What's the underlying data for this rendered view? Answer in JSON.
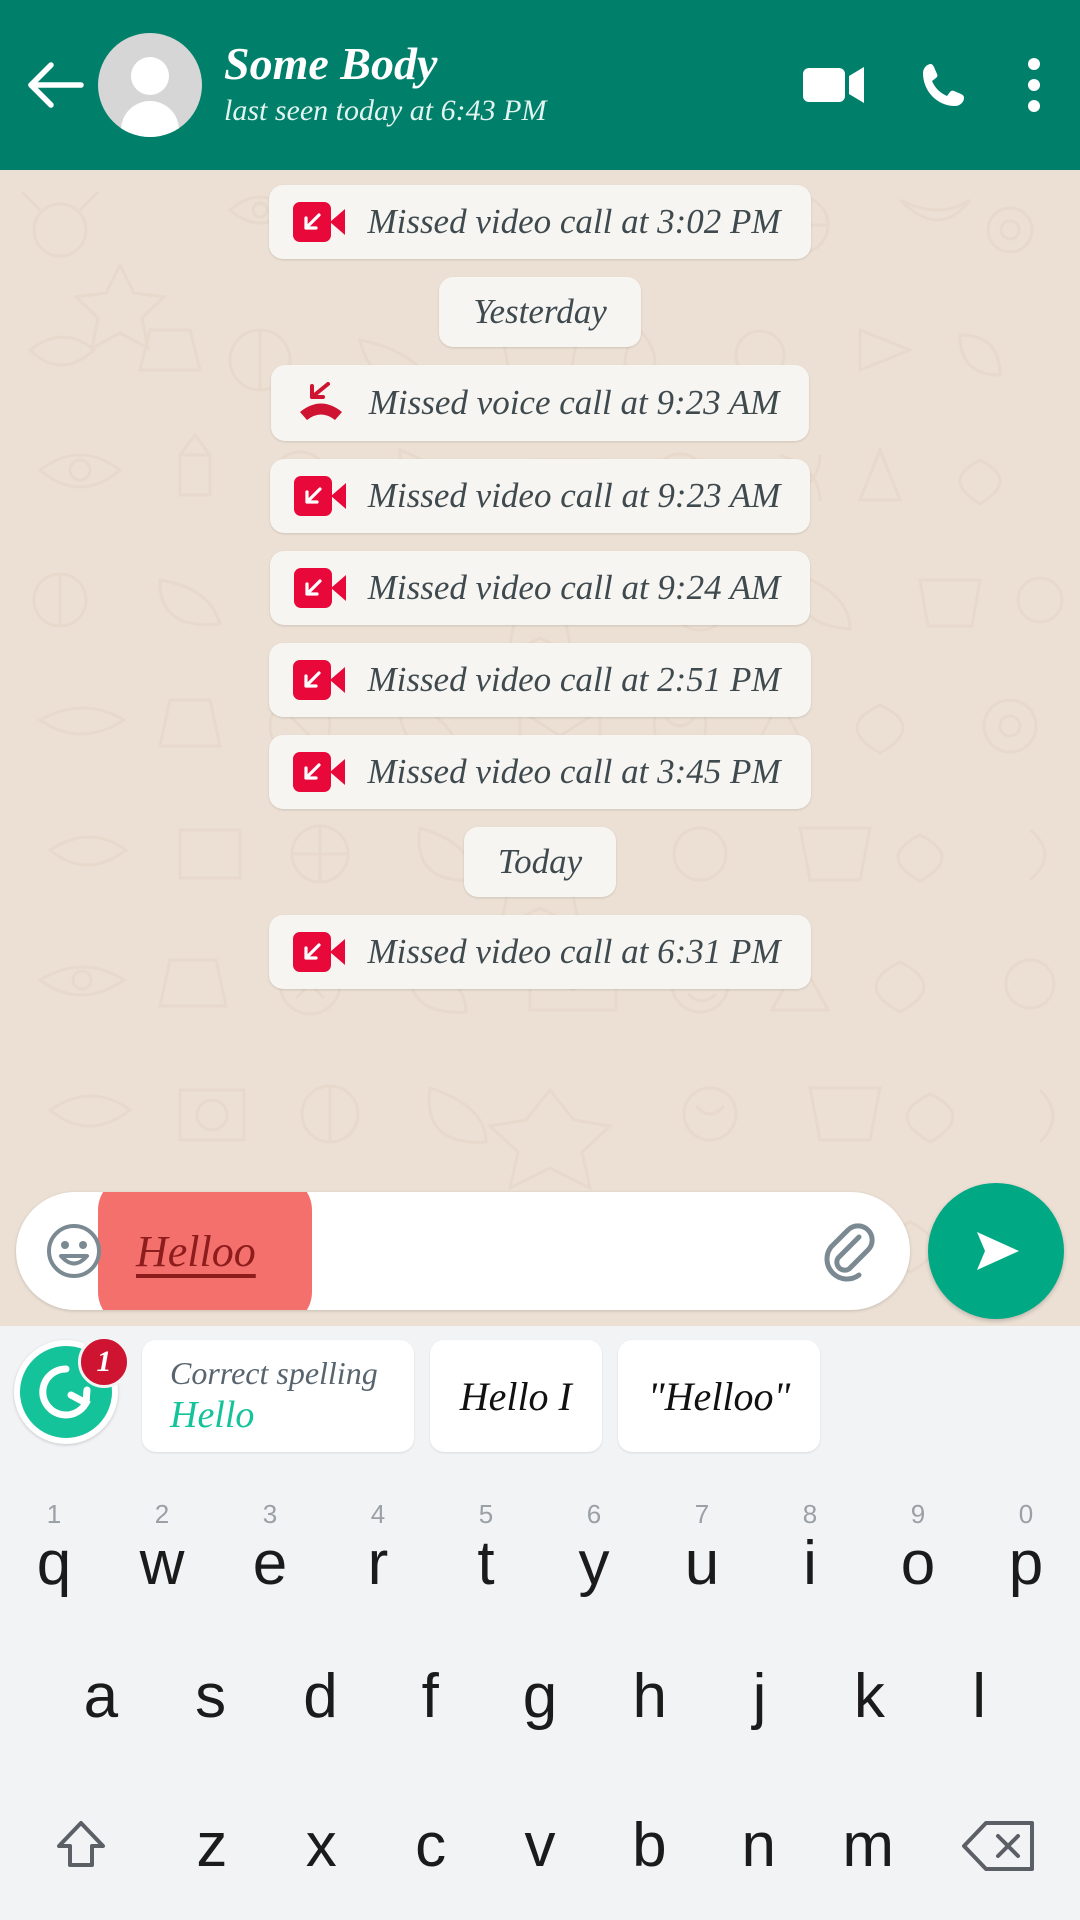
{
  "header": {
    "back_icon": "back-arrow-icon",
    "avatar_icon": "default-avatar-icon",
    "contact_name": "Some Body",
    "status": "last seen today at 6:43 PM",
    "video_call_icon": "video-camera-icon",
    "voice_call_icon": "phone-icon",
    "overflow_icon": "more-vertical-icon"
  },
  "chat": {
    "entries": [
      {
        "kind": "call",
        "call_type": "video",
        "icon": "missed-video-call-icon",
        "text": "Missed video call at 3:02 PM"
      },
      {
        "kind": "divider",
        "text": "Yesterday"
      },
      {
        "kind": "call",
        "call_type": "voice",
        "icon": "missed-voice-call-icon",
        "text": "Missed voice call at 9:23 AM"
      },
      {
        "kind": "call",
        "call_type": "video",
        "icon": "missed-video-call-icon",
        "text": "Missed video call at 9:23 AM"
      },
      {
        "kind": "call",
        "call_type": "video",
        "icon": "missed-video-call-icon",
        "text": "Missed video call at 9:24 AM"
      },
      {
        "kind": "call",
        "call_type": "video",
        "icon": "missed-video-call-icon",
        "text": "Missed video call at 2:51 PM"
      },
      {
        "kind": "call",
        "call_type": "video",
        "icon": "missed-video-call-icon",
        "text": "Missed video call at 3:45 PM"
      },
      {
        "kind": "divider",
        "text": "Today"
      },
      {
        "kind": "call",
        "call_type": "video",
        "icon": "missed-video-call-icon",
        "text": "Missed video call at 6:31 PM"
      }
    ]
  },
  "input_bar": {
    "emoji_icon": "smiley-face-icon",
    "message_value": "Helloo",
    "message_placeholder": "Message",
    "attach_icon": "paperclip-icon",
    "send_icon": "send-arrow-icon"
  },
  "suggestion_bar": {
    "grammarly_icon": "grammarly-logo-icon",
    "badge_count": "1",
    "spelling_card": {
      "title": "Correct spelling",
      "value": "Hello"
    },
    "suggestions": [
      {
        "label": "Hello I"
      },
      {
        "label": "\"Helloo\""
      }
    ]
  },
  "keyboard": {
    "row1": [
      {
        "letter": "q",
        "num": "1"
      },
      {
        "letter": "w",
        "num": "2"
      },
      {
        "letter": "e",
        "num": "3"
      },
      {
        "letter": "r",
        "num": "4"
      },
      {
        "letter": "t",
        "num": "5"
      },
      {
        "letter": "y",
        "num": "6"
      },
      {
        "letter": "u",
        "num": "7"
      },
      {
        "letter": "i",
        "num": "8"
      },
      {
        "letter": "o",
        "num": "9"
      },
      {
        "letter": "p",
        "num": "0"
      }
    ],
    "row2": [
      {
        "letter": "a"
      },
      {
        "letter": "s"
      },
      {
        "letter": "d"
      },
      {
        "letter": "f"
      },
      {
        "letter": "g"
      },
      {
        "letter": "h"
      },
      {
        "letter": "j"
      },
      {
        "letter": "k"
      },
      {
        "letter": "l"
      }
    ],
    "row3": [
      {
        "letter": "z"
      },
      {
        "letter": "x"
      },
      {
        "letter": "c"
      },
      {
        "letter": "v"
      },
      {
        "letter": "b"
      },
      {
        "letter": "n"
      },
      {
        "letter": "m"
      }
    ],
    "shift_icon": "shift-arrow-icon",
    "backspace_icon": "backspace-icon"
  },
  "colors": {
    "header_green": "#00806a",
    "send_green": "#00a884",
    "chat_bg": "#ece0d4",
    "bubble_bg": "#f7f5f2",
    "missed_call_red": "#e8093a",
    "highlight_salmon": "#f4706c",
    "spell_text_red": "#8d1c1c",
    "grammarly_green": "#15c39a",
    "badge_red": "#cf1431"
  }
}
